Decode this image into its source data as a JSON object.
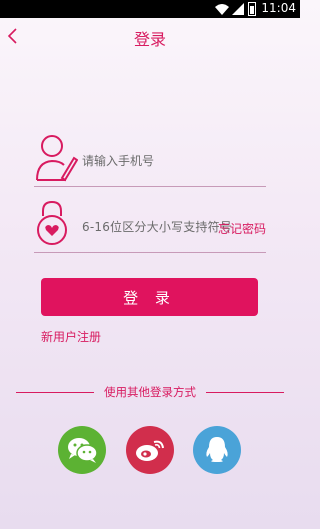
{
  "status_bar": {
    "time": "11:04"
  },
  "header": {
    "title": "登录"
  },
  "phone_field": {
    "placeholder": "请输入手机号"
  },
  "password_field": {
    "placeholder": "6-16位区分大小写支持符号"
  },
  "forgot_password": "忘记密码",
  "login_button": "登 录",
  "register_link": "新用户注册",
  "other_login": {
    "title": "使用其他登录方式",
    "providers": [
      "wechat",
      "weibo",
      "qq"
    ]
  },
  "colors": {
    "accent": "#e0135e",
    "wechat": "#5cb233",
    "weibo": "#d12e4c",
    "qq": "#4aa3d8"
  }
}
